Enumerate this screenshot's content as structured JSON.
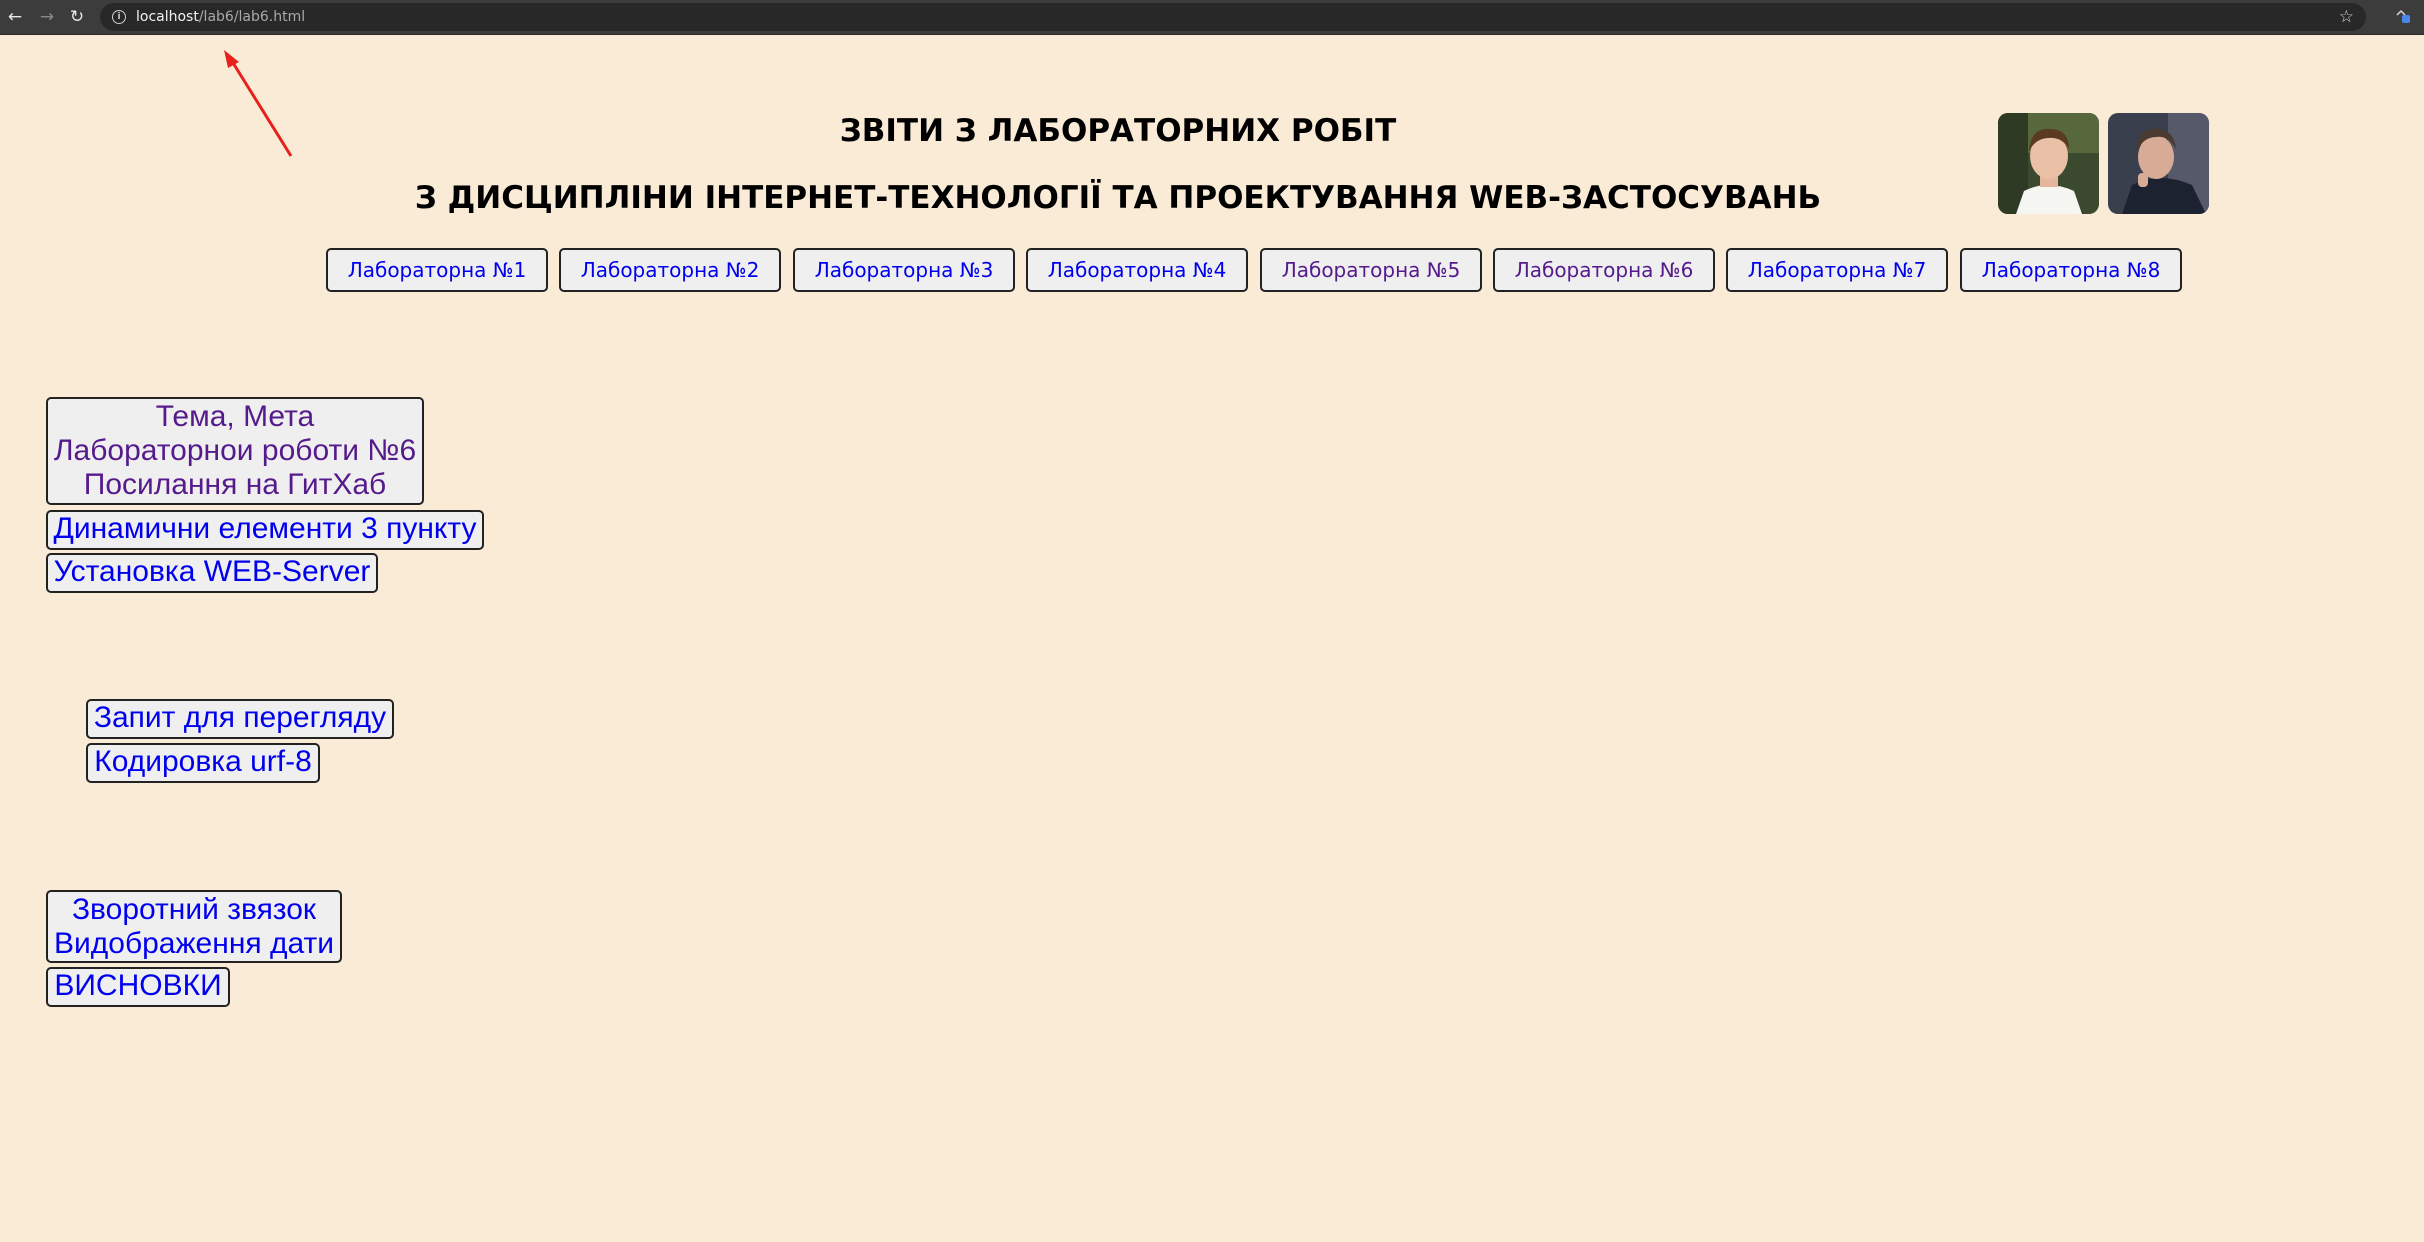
{
  "browser": {
    "url_host": "localhost",
    "url_path": "/lab6/lab6.html",
    "back_icon": "←",
    "forward_icon": "→",
    "reload_icon": "↻",
    "info_icon": "i",
    "star_icon": "☆"
  },
  "header": {
    "title_line1": "ЗВІТИ З ЛАБОРАТОРНИХ РОБІТ",
    "title_line2": "З ДИСЦИПЛІНИ ІНТЕРНЕТ-ТЕХНОЛОГІЇ ТА ПРОЕКТУВАННЯ WEB-ЗАСТОСУВАНЬ"
  },
  "nav": {
    "labs": [
      "Лабораторна №1",
      "Лабораторна №2",
      "Лабораторна №3",
      "Лабораторна №4",
      "Лабораторна №5",
      "Лабораторна №6",
      "Лабораторна №7",
      "Лабораторна №8"
    ]
  },
  "sidebar": {
    "topic_lines": [
      "Тема, Мета",
      "Лабораторнои роботи №6",
      "Посилання на ГитХаб"
    ],
    "dynamic": "Динамични елементи 3 пункту",
    "webserver": "Установка WEB-Server",
    "request": "Запит для перегляду",
    "encoding": "Кодировка urf-8",
    "feedback_lines": [
      "Зворотний звязок",
      "Видображення дати"
    ],
    "conclusions": "ВИСНОВКИ"
  },
  "colors": {
    "page_background": "#faebd7",
    "link": "#0000ee",
    "visited_link": "#551a8b",
    "annotation_arrow": "#e8201c"
  }
}
